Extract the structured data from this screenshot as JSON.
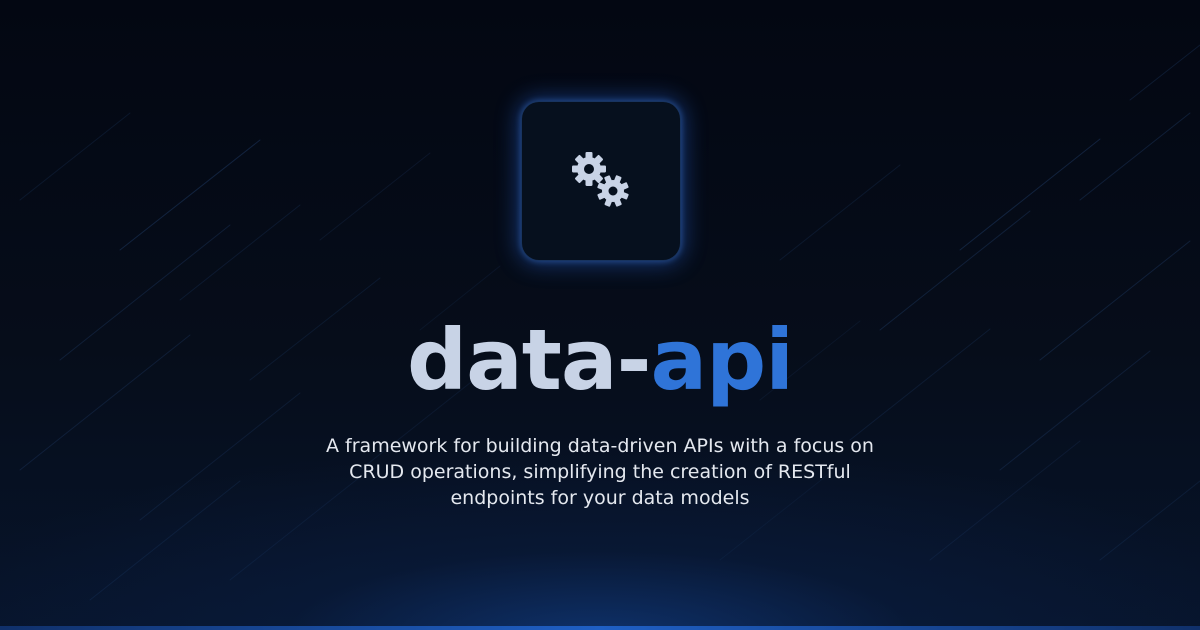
{
  "logo": {
    "icon": "gears-icon",
    "tile_color": "#06101e",
    "glow_color": "#2864d2",
    "gear_color": "#c8d3e6"
  },
  "title": {
    "part1": "data-",
    "part2": "api",
    "base_color": "#c8d3e6",
    "accent_color": "#2f74d8"
  },
  "tagline": "A framework for building data-driven APIs with a focus on CRUD operations, simplifying the creation of RESTful endpoints for your data models",
  "colors": {
    "background": "#050b16",
    "bottom_glow": "#1f5fc4"
  }
}
